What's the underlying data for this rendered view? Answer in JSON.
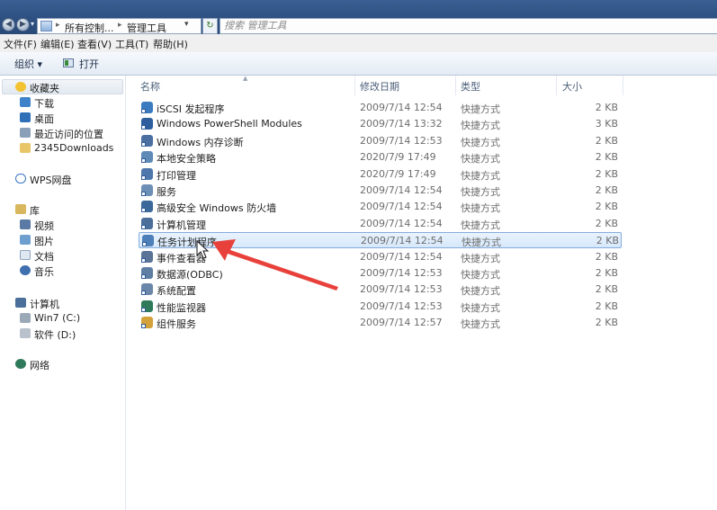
{
  "address": {
    "crumbs": [
      "所有控制...",
      "管理工具"
    ],
    "search_placeholder": "搜索 管理工具"
  },
  "menu": [
    "文件(F)",
    "编辑(E)",
    "查看(V)",
    "工具(T)",
    "帮助(H)"
  ],
  "toolbar": {
    "organize": "组织",
    "open": "打开"
  },
  "nav": {
    "favorites": "收藏夹",
    "fav_items": [
      "下载",
      "桌面",
      "最近访问的位置",
      "2345Downloads"
    ],
    "wps": "WPS网盘",
    "library": "库",
    "lib_items": [
      "视频",
      "图片",
      "文档",
      "音乐"
    ],
    "computer": "计算机",
    "drives": [
      "Win7 (C:)",
      "软件 (D:)"
    ],
    "network": "网络"
  },
  "columns": {
    "name": "名称",
    "date": "修改日期",
    "type": "类型",
    "size": "大小"
  },
  "files": [
    {
      "name": "iSCSI 发起程序",
      "date": "2009/7/14 12:54",
      "type": "快捷方式",
      "size": "2 KB"
    },
    {
      "name": "Windows PowerShell Modules",
      "date": "2009/7/14 13:32",
      "type": "快捷方式",
      "size": "3 KB"
    },
    {
      "name": "Windows 内存诊断",
      "date": "2009/7/14 12:53",
      "type": "快捷方式",
      "size": "2 KB"
    },
    {
      "name": "本地安全策略",
      "date": "2020/7/9 17:49",
      "type": "快捷方式",
      "size": "2 KB"
    },
    {
      "name": "打印管理",
      "date": "2020/7/9 17:49",
      "type": "快捷方式",
      "size": "2 KB"
    },
    {
      "name": "服务",
      "date": "2009/7/14 12:54",
      "type": "快捷方式",
      "size": "2 KB"
    },
    {
      "name": "高级安全 Windows 防火墙",
      "date": "2009/7/14 12:54",
      "type": "快捷方式",
      "size": "2 KB"
    },
    {
      "name": "计算机管理",
      "date": "2009/7/14 12:54",
      "type": "快捷方式",
      "size": "2 KB"
    },
    {
      "name": "任务计划程序",
      "date": "2009/7/14 12:54",
      "type": "快捷方式",
      "size": "2 KB"
    },
    {
      "name": "事件查看器",
      "date": "2009/7/14 12:54",
      "type": "快捷方式",
      "size": "2 KB"
    },
    {
      "name": "数据源(ODBC)",
      "date": "2009/7/14 12:53",
      "type": "快捷方式",
      "size": "2 KB"
    },
    {
      "name": "系统配置",
      "date": "2009/7/14 12:53",
      "type": "快捷方式",
      "size": "2 KB"
    },
    {
      "name": "性能监视器",
      "date": "2009/7/14 12:53",
      "type": "快捷方式",
      "size": "2 KB"
    },
    {
      "name": "组件服务",
      "date": "2009/7/14 12:57",
      "type": "快捷方式",
      "size": "2 KB"
    }
  ],
  "selected_index": 8,
  "colors": {
    "accent": "#e8413b",
    "selection": "#d6e8fb",
    "title_bar": "#2c4f80"
  }
}
